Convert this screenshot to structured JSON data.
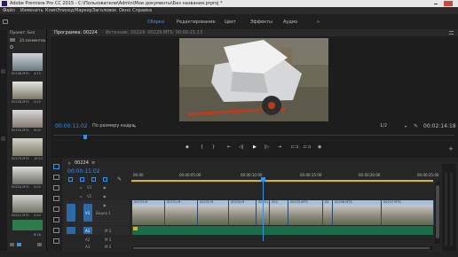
{
  "app": {
    "title": "Adobe Premiere Pro CC 2015 - C:\\Пользователи\\Admin\\Мои документы\\Без названия.prproj *"
  },
  "menu": [
    "Файл",
    "Изменить",
    "Клип",
    "Эпизод",
    "Маркер",
    "Заголовок",
    "Окно",
    "Справка"
  ],
  "workspaces": [
    "Сборка",
    "Редактирование",
    "Цвет",
    "Эффекты",
    "Аудио"
  ],
  "workspace_more": "»",
  "project_panel": {
    "title": "Проект: Без",
    "count_label": "24 элементов",
    "thumb_labels": [
      "00148.MTS",
      "00128.MTS",
      "00155.MTS",
      "00170.MTS",
      "00220.MTS",
      "00221.MTS",
      "00224"
    ],
    "thumb_times": [
      "4:15",
      "2:25",
      "9:04",
      "15:11",
      "5:05",
      "5:20",
      "6:18"
    ]
  },
  "monitor": {
    "tab_program": "Программа: 00224",
    "tab_source": "Источник: 00224: 00229.MTS: 00:00:21:13",
    "timecode_left": "00:00:11:02",
    "fit_label": "По размеру кадра",
    "quality_label": "1/2",
    "timecode_right": "00:02:14:18"
  },
  "transport": [
    "◆",
    "{",
    "}",
    "⇤",
    "◁|",
    "▶",
    "|▷",
    "⇥",
    "⊏⊐",
    "⊏⊐",
    "◉"
  ],
  "timeline": {
    "tab_label": "00224",
    "timecode": "00:00:11:02",
    "ruler_labels": [
      "00:00",
      "00:00:05:00",
      "00:00:10:00",
      "00:00:15:00",
      "00:00:20:00",
      "00:00:25:00"
    ],
    "tracks": [
      {
        "name": "V3",
        "label": ""
      },
      {
        "name": "V2",
        "label": ""
      },
      {
        "name": "V1",
        "label": "Видео 1"
      },
      {
        "name": "A1",
        "label": "M  S"
      },
      {
        "name": "A2",
        "label": "M  S"
      },
      {
        "name": "A3",
        "label": "M  S"
      }
    ],
    "clips": [
      "00233.M",
      "00231.M",
      "00232.M",
      "00230.M",
      "00231.M",
      "002",
      "00233.MTS",
      "00",
      "00236.MTS",
      "00237.MTS"
    ]
  },
  "colors": {
    "accent": "#3d8fe0",
    "clip_video": "#7b93ad",
    "clip_audio": "#1b6d4a",
    "playhead": "#3d8fe0"
  }
}
